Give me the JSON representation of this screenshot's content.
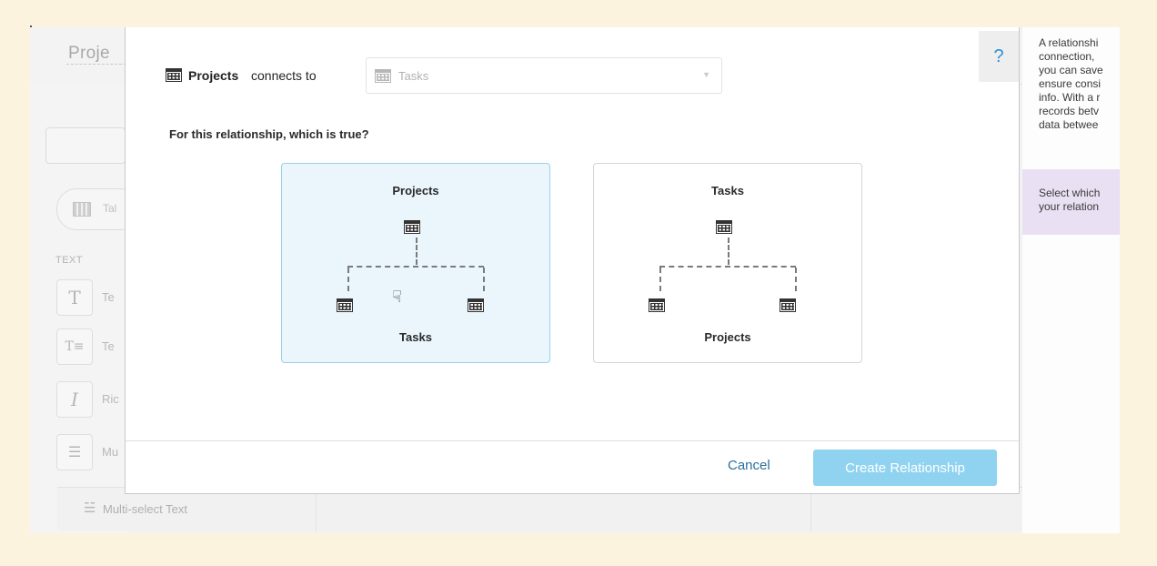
{
  "app": {
    "title": "Proje",
    "sidebar": {
      "pill_label": "Tal",
      "section_label": "TEXT",
      "items": [
        {
          "icon_char": "T",
          "label": "Te"
        },
        {
          "icon_char": "T≡",
          "label": "Te"
        },
        {
          "icon_char": "I",
          "label": "Ric"
        },
        {
          "icon_char": "☰",
          "label": "Mu"
        }
      ],
      "row_icon": "☱",
      "row_label": "Multi-select Text"
    }
  },
  "help_panel": {
    "intro": "A relationshi\nconnection,\nyou can save\nensure consi\ninfo. With a r\nrecords betv\ndata betwee",
    "highlight": "Select which\nyour relation"
  },
  "modal": {
    "help_button": "?",
    "source_table": "Projects",
    "connects_text": "connects to",
    "target_select": {
      "value": "Tasks"
    },
    "question": "For this relationship, which is true?",
    "options": [
      {
        "top_label": "Projects",
        "bottom_label": "Tasks",
        "selected": true
      },
      {
        "top_label": "Tasks",
        "bottom_label": "Projects",
        "selected": false
      }
    ],
    "cancel_label": "Cancel",
    "create_label": "Create Relationship"
  },
  "colors": {
    "accent": "#2b6f9e",
    "primary_button": "#8fd3f0",
    "selected_option_bg": "#eaf6fc",
    "highlight_panel": "#e9e0f3",
    "help_icon": "#2a93d5"
  }
}
